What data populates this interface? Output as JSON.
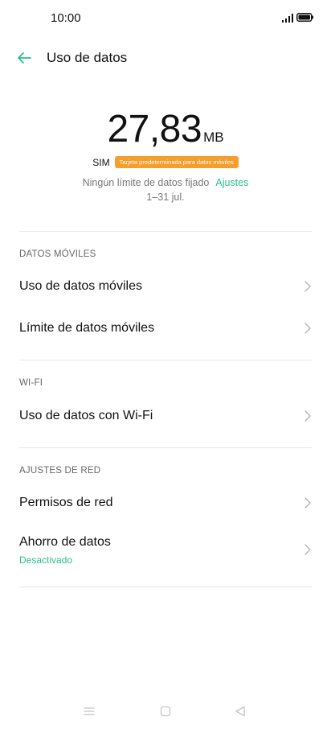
{
  "status_bar": {
    "time": "10:00"
  },
  "header": {
    "title": "Uso de datos"
  },
  "summary": {
    "value": "27,83",
    "unit": "MB",
    "sim_label": "SIM",
    "sim_badge": "Tarjeta predeterminada para datos móviles",
    "limit_text": "Ningún límite de datos fijado",
    "settings_link": "Ajustes",
    "period": "1–31 jul."
  },
  "sections": {
    "mobile": {
      "header": "DATOS MÓVILES",
      "items": [
        {
          "label": "Uso de datos móviles"
        },
        {
          "label": "Límite de datos móviles"
        }
      ]
    },
    "wifi": {
      "header": "WI-FI",
      "items": [
        {
          "label": "Uso de datos con Wi-Fi"
        }
      ]
    },
    "network": {
      "header": "AJUSTES DE RED",
      "items": [
        {
          "label": "Permisos de red"
        },
        {
          "label": "Ahorro de datos",
          "sub": "Desactivado"
        }
      ]
    }
  },
  "colors": {
    "accent": "#2dbd8c",
    "badge": "#f59e2b"
  },
  "icons": [
    "signal-icon",
    "battery-icon",
    "back-arrow-icon",
    "chevron-right-icon",
    "menu-icon",
    "home-icon",
    "back-icon"
  ]
}
